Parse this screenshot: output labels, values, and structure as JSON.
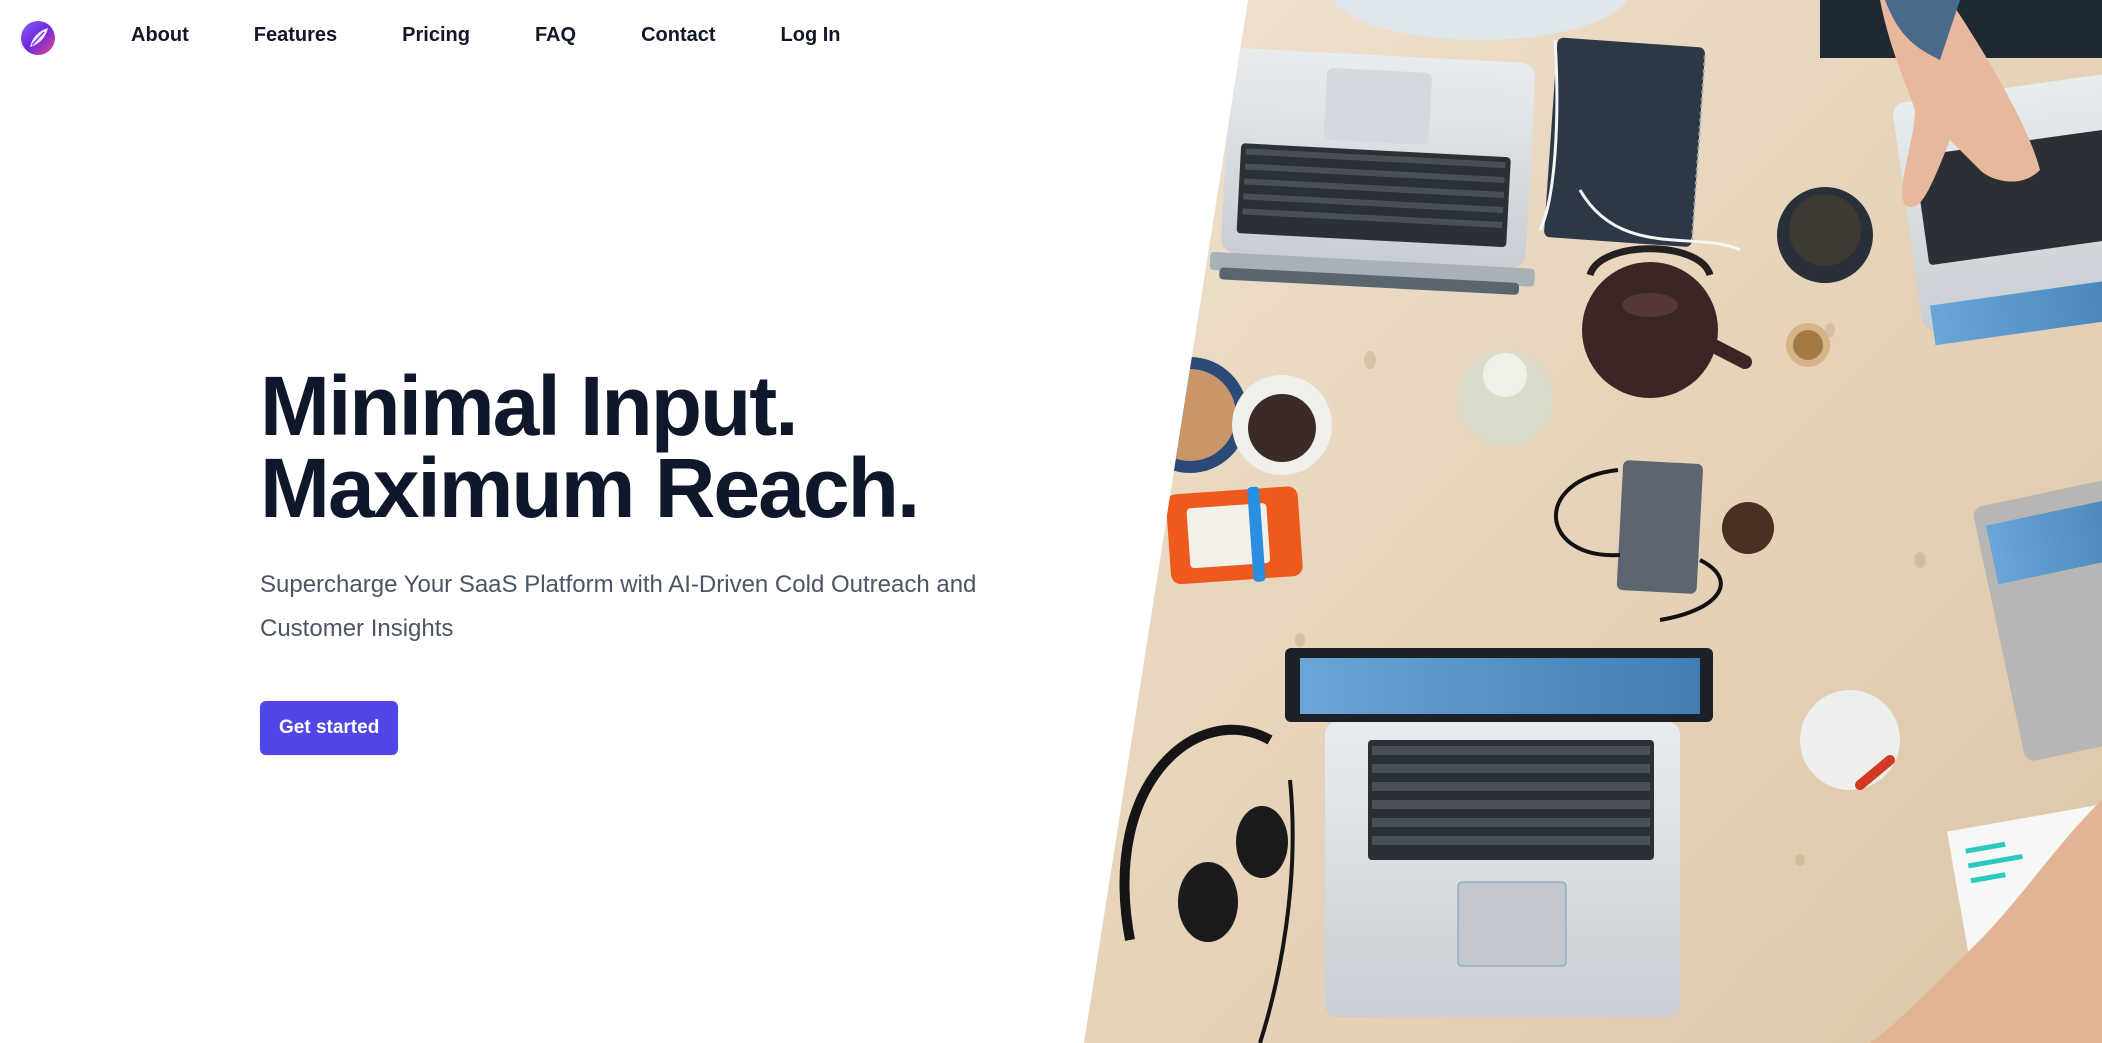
{
  "nav": {
    "logo_icon": "feather-logo-icon",
    "links": [
      {
        "label": "About"
      },
      {
        "label": "Features"
      },
      {
        "label": "Pricing"
      },
      {
        "label": "FAQ"
      },
      {
        "label": "Contact"
      },
      {
        "label": "Log In"
      }
    ]
  },
  "hero": {
    "title_line1": "Minimal Input.",
    "title_line2": "Maximum Reach.",
    "subtitle": "Supercharge Your SaaS Platform with AI-Driven Cold Outreach and Customer Insights",
    "cta_label": "Get started"
  },
  "image": {
    "description_icon": "desk-photo"
  },
  "colors": {
    "accent": "#5046e5",
    "heading": "#0f172a",
    "body_text": "#4b5563",
    "wood": "#e9d9c3"
  }
}
